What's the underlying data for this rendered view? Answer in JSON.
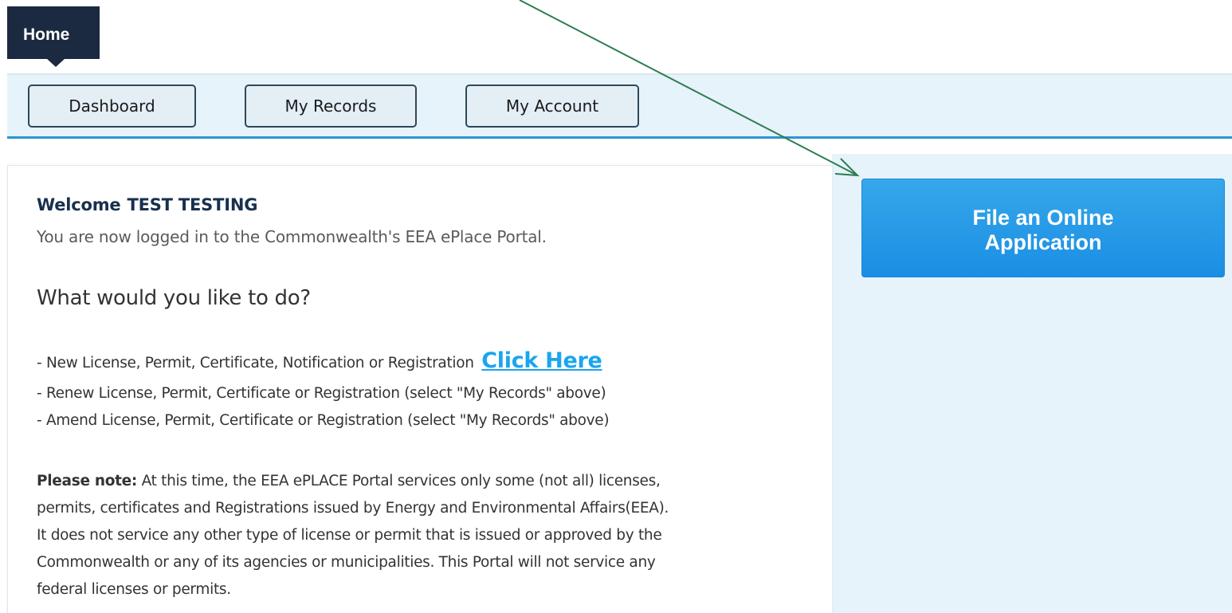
{
  "nav": {
    "home_label": "Home",
    "dashboard_label": "Dashboard",
    "records_label": "My Records",
    "account_label": "My Account"
  },
  "welcome": {
    "prefix": "Welcome",
    "user": "TEST TESTING",
    "logged_in_text": "You are now logged in to the Commonwealth's EEA ePlace Portal."
  },
  "options": {
    "question": "What would you like to do?",
    "new_text": "- New License, Permit, Certificate, Notification or Registration",
    "click_here": "Click Here",
    "renew_text": "- Renew License, Permit, Certificate or Registration (select \"My Records\" above)",
    "amend_text": "- Amend License, Permit, Certificate or Registration (select \"My Records\" above)"
  },
  "note": {
    "label": "Please note:",
    "line1": " At this time, the EEA ePLACE Portal services only some (not all) licenses,",
    "line2": "permits, certificates and Registrations issued by Energy and Environmental Affairs(EEA).",
    "line3": "It does not service any other type of license or permit that is issued or approved by the",
    "line4": "Commonwealth or any of its agencies or municipalities. This Portal will not service any",
    "line5": "federal licenses or permits."
  },
  "side": {
    "file_button_line1": "File an Online",
    "file_button_line2": "Application"
  },
  "colors": {
    "nav_dark": "#1b2a41",
    "nav_band": "#e6f3fb",
    "accent_blue": "#1a8ee4",
    "link_blue": "#1ba5ef",
    "annotation_arrow": "#2e7d4f"
  }
}
